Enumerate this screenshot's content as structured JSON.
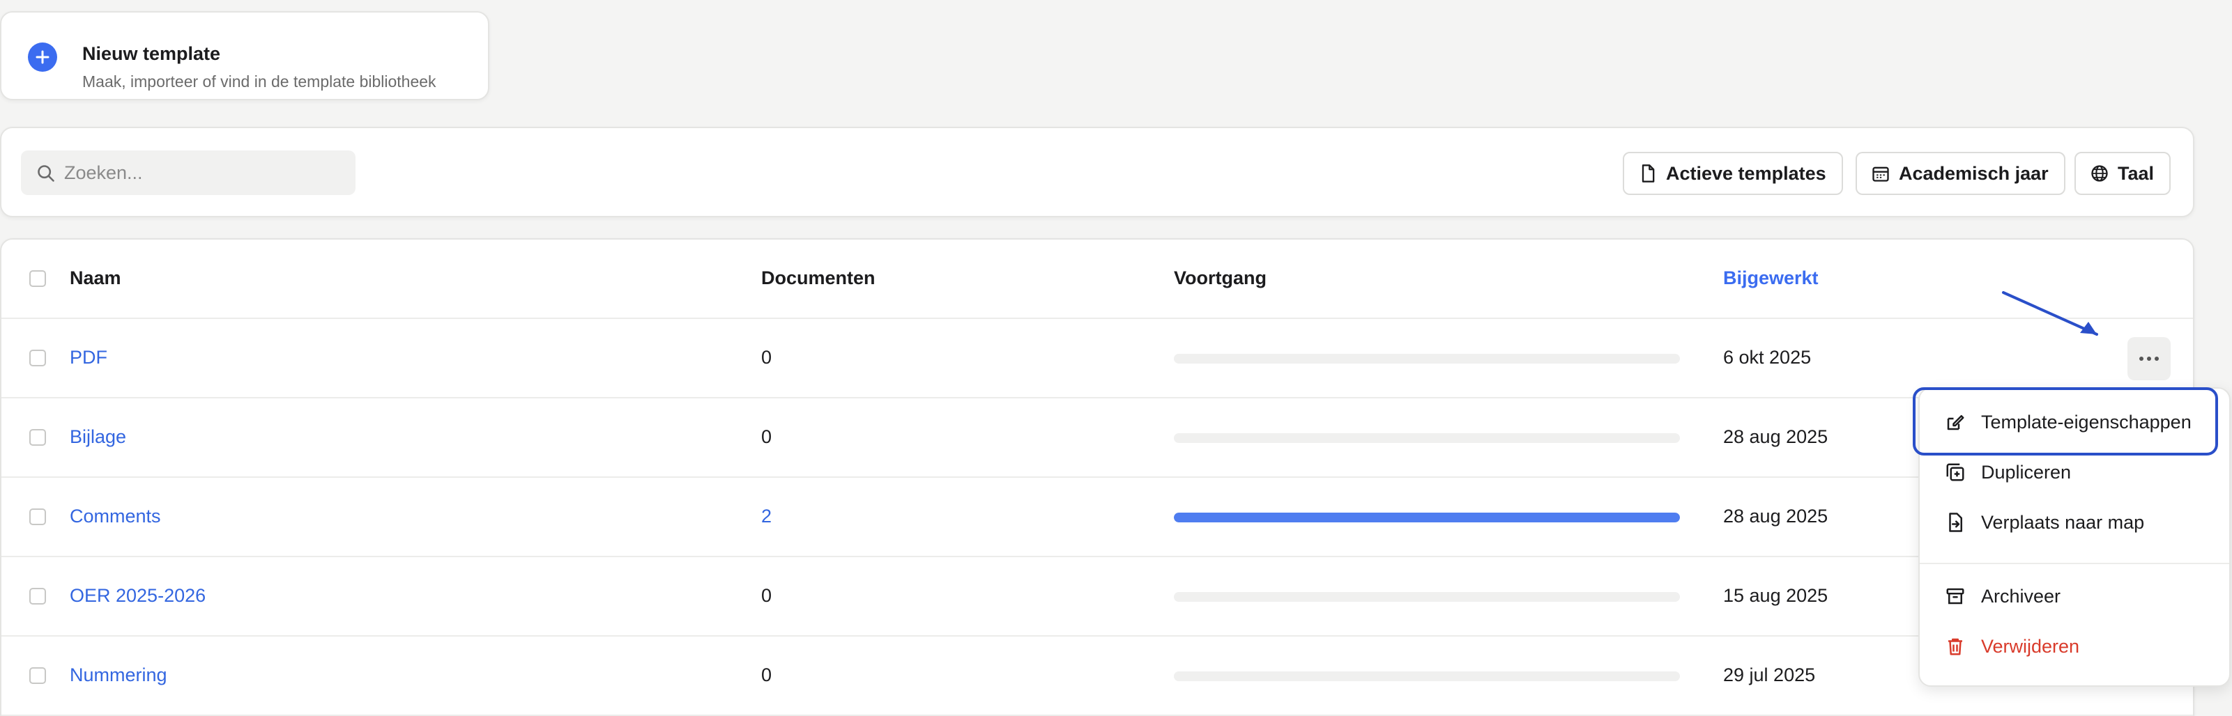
{
  "new_template": {
    "title": "Nieuw template",
    "subtitle": "Maak, importeer of vind in de template bibliotheek",
    "icon": "plus-circle-icon"
  },
  "toolbar": {
    "search_placeholder": "Zoeken...",
    "filters": [
      {
        "label": "Actieve templates",
        "icon": "document-icon"
      },
      {
        "label": "Academisch jaar",
        "icon": "calendar-icon"
      },
      {
        "label": "Taal",
        "icon": "globe-icon"
      }
    ]
  },
  "table": {
    "columns": {
      "name": "Naam",
      "documents": "Documenten",
      "progress": "Voortgang",
      "updated": "Bijgewerkt"
    },
    "sorted_column": "updated",
    "rows": [
      {
        "name": "PDF",
        "documents": "0",
        "progress": 0,
        "updated": "6 okt 2025"
      },
      {
        "name": "Bijlage",
        "documents": "0",
        "progress": 0,
        "updated": "28 aug 2025"
      },
      {
        "name": "Comments",
        "documents": "2",
        "progress": 100,
        "updated": "28 aug 2025"
      },
      {
        "name": "OER 2025-2026",
        "documents": "0",
        "progress": 0,
        "updated": "15 aug 2025"
      },
      {
        "name": "Nummering",
        "documents": "0",
        "progress": 0,
        "updated": "29 jul 2025"
      }
    ]
  },
  "context_menu": {
    "items": [
      {
        "label": "Template-eigenschappen",
        "icon": "edit-icon"
      },
      {
        "label": "Dupliceren",
        "icon": "duplicate-icon"
      },
      {
        "label": "Verplaats naar map",
        "icon": "move-file-icon"
      },
      {
        "label": "Archiveer",
        "icon": "archive-icon"
      },
      {
        "label": "Verwijderen",
        "icon": "trash-icon",
        "danger": true
      }
    ]
  },
  "colors": {
    "accent": "#3b6cf0",
    "link": "#3366e0",
    "danger": "#d93b2b",
    "highlight": "#2a4fc9"
  }
}
